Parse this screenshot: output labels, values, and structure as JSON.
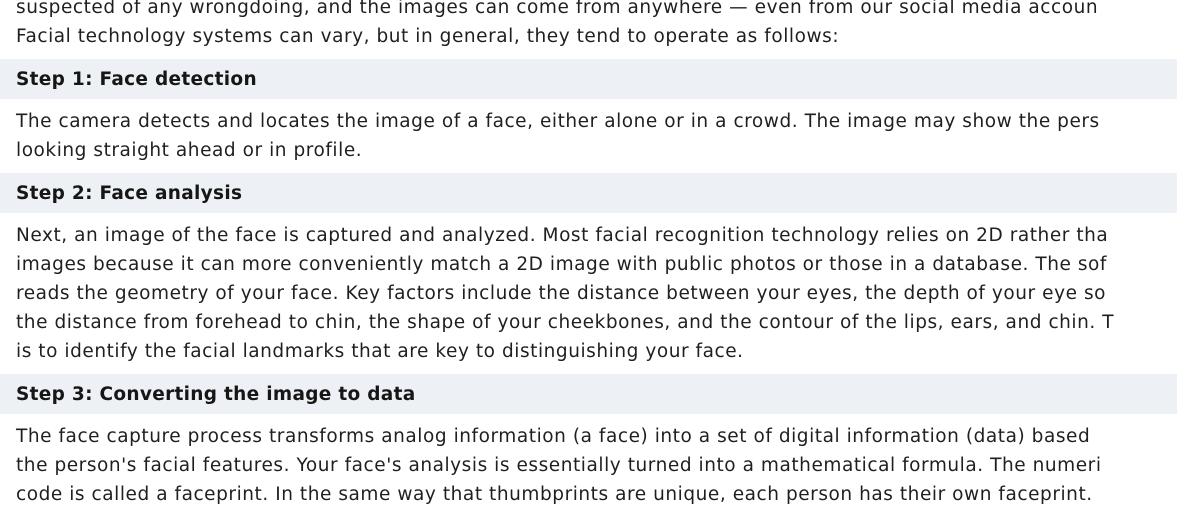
{
  "intro": {
    "lines": [
      "suspected of any wrongdoing, and the images can come from anywhere — even from our social media accoun",
      "Facial technology systems can vary, but in general, they tend to operate as follows:"
    ]
  },
  "sections": [
    {
      "heading": "Step 1: Face detection",
      "lines": [
        "The camera detects and locates the image of a face, either alone or in a crowd. The image may show the pers",
        "looking straight ahead or in profile."
      ]
    },
    {
      "heading": "Step 2: Face analysis",
      "lines": [
        "Next, an image of the face is captured and analyzed. Most facial recognition technology relies on 2D rather tha",
        "images because it can more conveniently match a 2D image with public photos or those in a database. The sof",
        "reads the geometry of your face. Key factors include the distance between your eyes, the depth of your eye so",
        "the distance from forehead to chin, the shape of your cheekbones, and the contour of the lips, ears, and chin. T",
        "is to identify the facial landmarks that are key to distinguishing your face."
      ]
    },
    {
      "heading": "Step 3: Converting the image to data",
      "lines": [
        "The face capture process transforms analog information (a face) into a set of digital information (data) based",
        "the person's facial features. Your face's analysis is essentially turned into a mathematical formula. The numeri",
        "code is called a faceprint. In the same way that thumbprints are unique, each person has their own faceprint."
      ]
    }
  ]
}
